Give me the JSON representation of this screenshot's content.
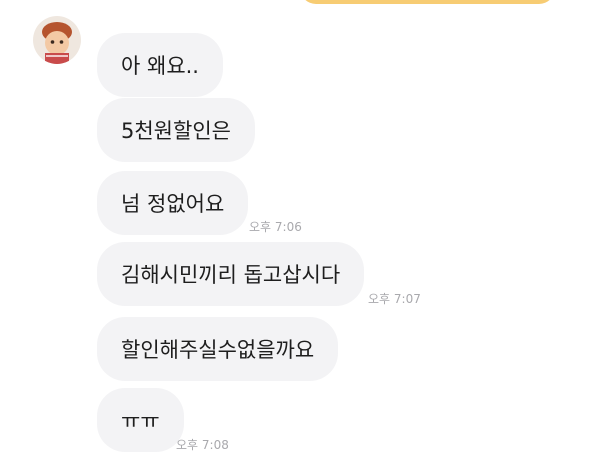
{
  "chat": {
    "messages": [
      {
        "text": "아 왜요..",
        "time": ""
      },
      {
        "text": "5천원할인은",
        "time": ""
      },
      {
        "text": "넘 정없어요",
        "time": "오후 7:06"
      },
      {
        "text": "김해시민끼리 돕고삽시다",
        "time": "오후 7:07"
      },
      {
        "text": "할인해주실수없을까요",
        "time": ""
      },
      {
        "text": "ㅠㅠ",
        "time": "오후 7:08"
      }
    ]
  },
  "colors": {
    "incoming_bubble": "#f3f3f5",
    "outgoing_bubble": "#f6c35a",
    "timestamp": "#a9a9ad"
  }
}
